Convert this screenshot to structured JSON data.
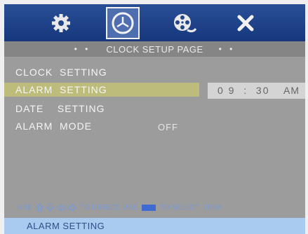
{
  "tabs": [
    {
      "icon": "gear-icon",
      "selected": false
    },
    {
      "icon": "clock-icon",
      "selected": true
    },
    {
      "icon": "film-reel-icon",
      "selected": false
    },
    {
      "icon": "close-icon",
      "selected": false
    }
  ],
  "title": {
    "left_dots": "• •",
    "text": "CLOCK SETUP PAGE",
    "right_dots": "• •"
  },
  "menu": {
    "items": [
      {
        "label": "CLOCK  SETTING",
        "highlighted": false
      },
      {
        "label": "ALARM  SETTING",
        "highlighted": true
      },
      {
        "label": "DATE    SETTING",
        "highlighted": false
      },
      {
        "label": "ALARM  MODE",
        "highlighted": false
      }
    ],
    "alarm_time": {
      "time": "0 9  :  30",
      "ampm": "AM"
    },
    "alarm_mode_value": "OFF"
  },
  "help": {
    "prefix": "USE",
    "arrows": [
      "up-arrow-icon",
      "down-arrow-icon",
      "left-arrow-icon",
      "right-arrow-icon"
    ],
    "direct_text": "TO DIRECT, USE",
    "enter_icon": "enter-key-icon",
    "select_text": "TO SELECT  ITEM"
  },
  "status": {
    "text": "ALARM SETTING"
  },
  "colors": {
    "icon_bar": "#1f4589",
    "panel": "#9c9c9c",
    "highlight": "#bdbc7a",
    "status_bar": "#a8cbef",
    "help_text": "#7a9ad6"
  }
}
